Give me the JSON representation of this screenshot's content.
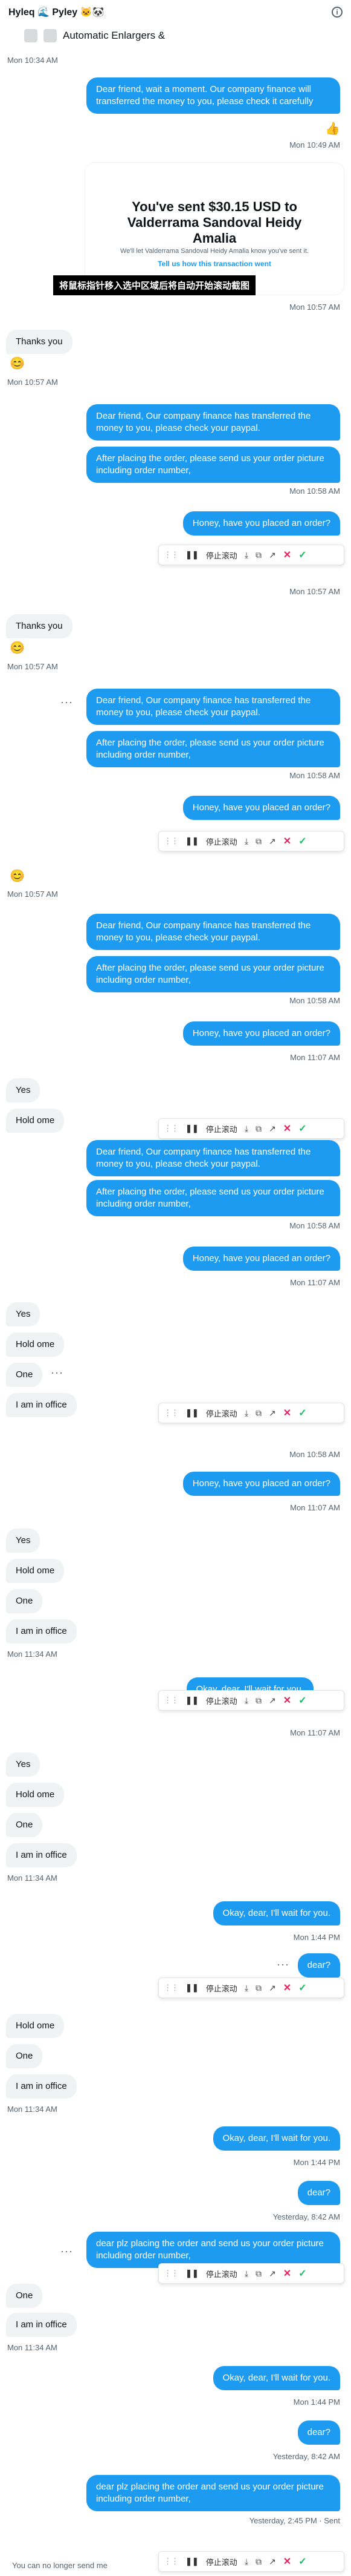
{
  "header": {
    "name": "Hyleq 🌊 Pyley 🐱🐼",
    "info_icon": "info-icon"
  },
  "top_strip": {
    "text": "Automatic Enlargers &"
  },
  "hint_banner": "将鼠标指针移入选中区域后将自动开始滚动截图",
  "card": {
    "title": "You've sent $30.15 USD to Valderrama Sandoval Heidy Amalia",
    "sub": "We'll let Valderrama Sandoval Heidy Amalia know you've sent it.",
    "link": "Tell us how this transaction went"
  },
  "toolbar": {
    "pause_label": "停止滚动"
  },
  "messages": {
    "m01_ts": "Mon 10:34 AM",
    "m02": "Dear friend, wait a moment. Our company finance will transferred the money to you, please check it carefully",
    "m02_ts": "Mon 10:49 AM",
    "m03_ts": "Mon 10:57 AM",
    "thanks": "Thanks you",
    "smile": "😊",
    "ts_1057": "Mon 10:57 AM",
    "paypal1": "Dear friend, Our company finance has transferred the money to you, please check your paypal.",
    "after": "After placing the order, please send us your order picture including order number,",
    "ts_1058": "Mon 10:58 AM",
    "honey": "Honey, have you placed an order?",
    "ts_1107": "Mon 11:07 AM",
    "yes": "Yes",
    "hold": "Hold ome",
    "one": "One",
    "office": "I am in office",
    "ts_1134": "Mon 11:34 AM",
    "okay": "Okay, dear, I'll wait for you.",
    "ts_144": "Mon 1:44 PM",
    "dear": "dear?",
    "ts_yest842": "Yesterday, 8:42 AM",
    "dearplz": "dear plz  placing the order and send us your order picture including order number,",
    "ts_yest245": "Yesterday, 2:45 PM · Sent",
    "footer": "You can no longer send me"
  }
}
